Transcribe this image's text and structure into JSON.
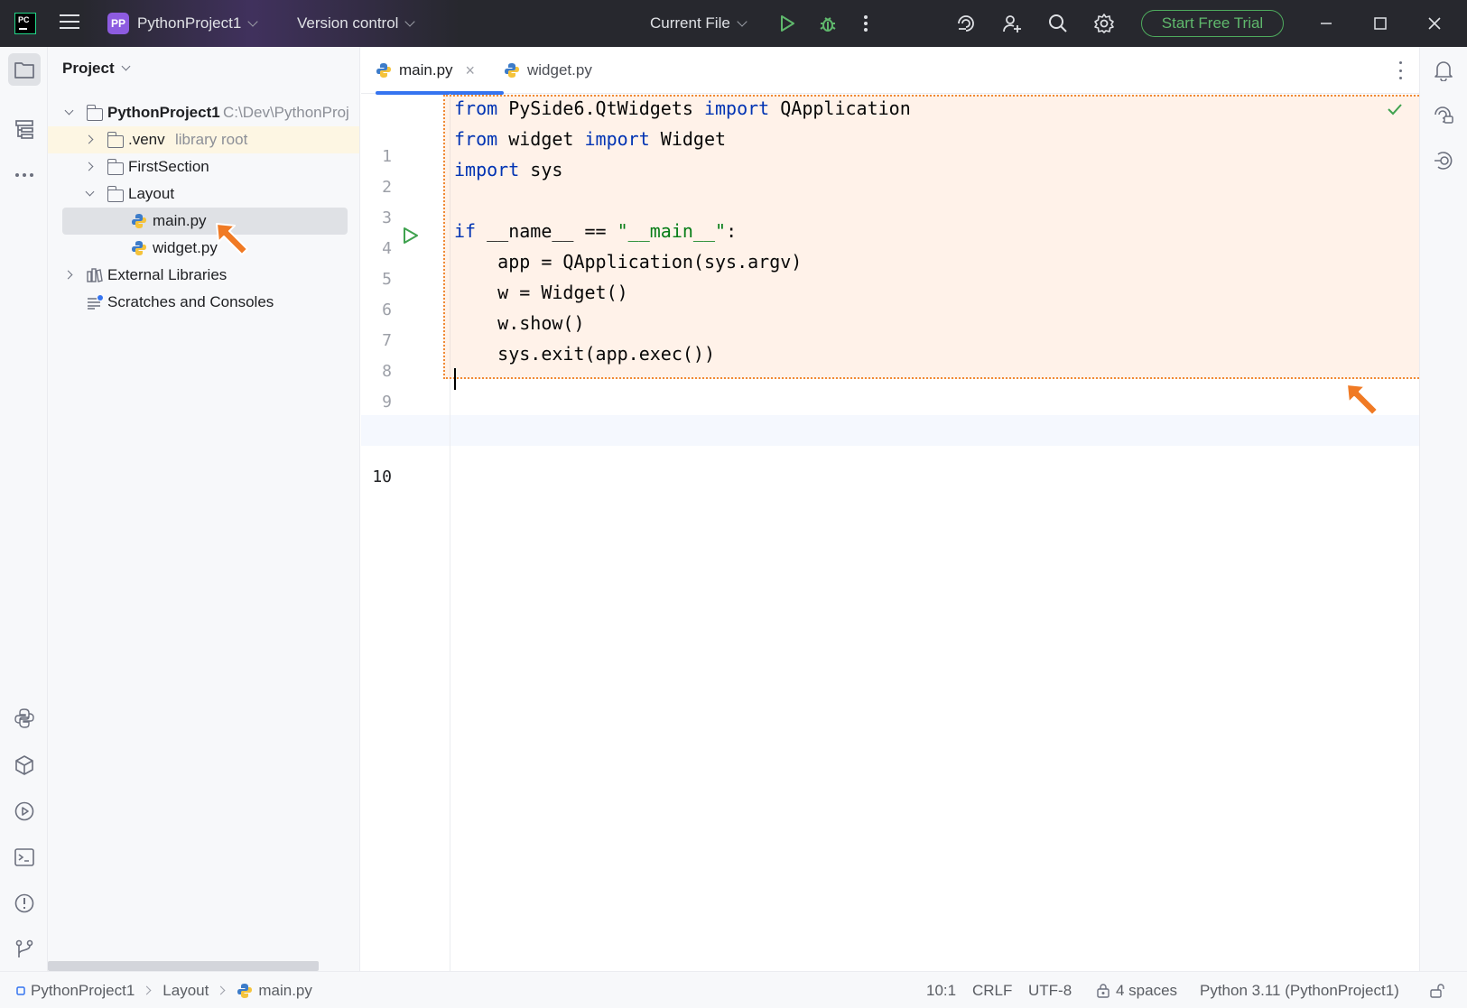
{
  "titlebar": {
    "project_badge": "PP",
    "project_name": "PythonProject1",
    "vcs": "Version control",
    "run_config": "Current File",
    "trial_button": "Start Free Trial"
  },
  "project_panel": {
    "title": "Project",
    "tree": {
      "root_name": "PythonProject1",
      "root_path": "C:\\Dev\\PythonProj",
      "venv_name": ".venv",
      "venv_tag": "library root",
      "first_section": "FirstSection",
      "layout": "Layout",
      "main_py": "main.py",
      "widget_py": "widget.py",
      "external_libraries": "External Libraries",
      "scratches": "Scratches and Consoles"
    }
  },
  "editor": {
    "tabs": [
      {
        "label": "main.py",
        "active": true
      },
      {
        "label": "widget.py",
        "active": false
      }
    ],
    "line_numbers": [
      "1",
      "2",
      "3",
      "4",
      "5",
      "6",
      "7",
      "8",
      "9",
      "10"
    ],
    "code": {
      "l1_kw1": "from",
      "l1_t1": " PySide6.QtWidgets ",
      "l1_kw2": "import",
      "l1_t2": " QApplication",
      "l2_kw1": "from",
      "l2_t1": " widget ",
      "l2_kw2": "import",
      "l2_t2": " Widget",
      "l3_kw1": "import",
      "l3_t1": " sys",
      "l5_kw1": "if",
      "l5_t1": " __name__ == ",
      "l5_str": "\"__main__\"",
      "l5_t2": ":",
      "l6": "    app = QApplication(sys.argv)",
      "l7": "    w = Widget()",
      "l8": "    w.show()",
      "l9": "    sys.exit(app.exec())"
    }
  },
  "statusbar": {
    "crumbs": [
      "PythonProject1",
      "Layout",
      "main.py"
    ],
    "position": "10:1",
    "line_sep": "CRLF",
    "encoding": "UTF-8",
    "indent": "4 spaces",
    "interpreter": "Python 3.11 (PythonProject1)"
  },
  "colors": {
    "accent": "#3574f0",
    "keyword": "#0033b3",
    "string": "#067d17",
    "annotation": "#f08a35"
  }
}
